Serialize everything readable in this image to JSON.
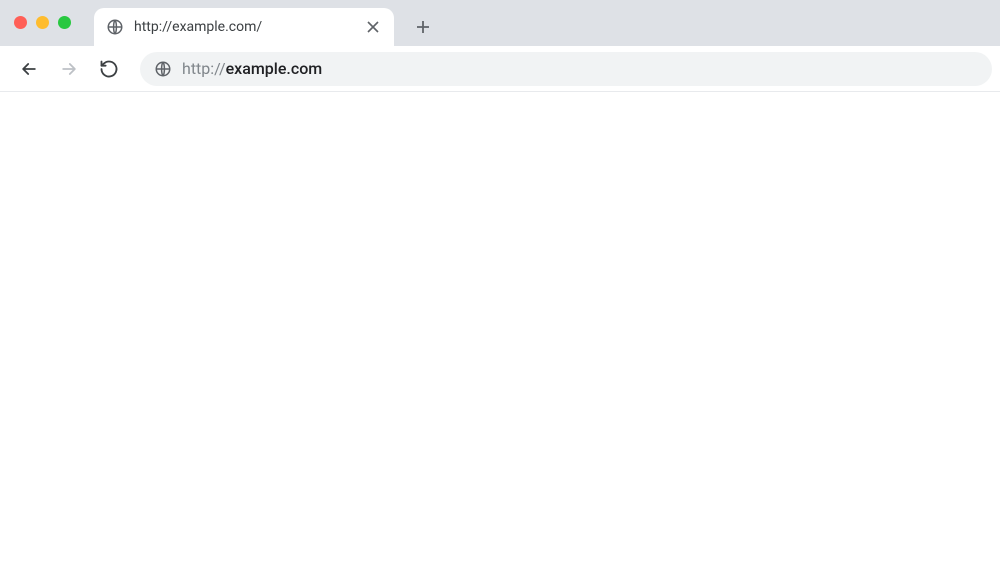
{
  "window": {
    "controls": {
      "close": "close",
      "minimize": "minimize",
      "maximize": "maximize"
    }
  },
  "tabs": [
    {
      "title": "http://example.com/"
    }
  ],
  "address": {
    "scheme": "http://",
    "host": "example.com"
  }
}
